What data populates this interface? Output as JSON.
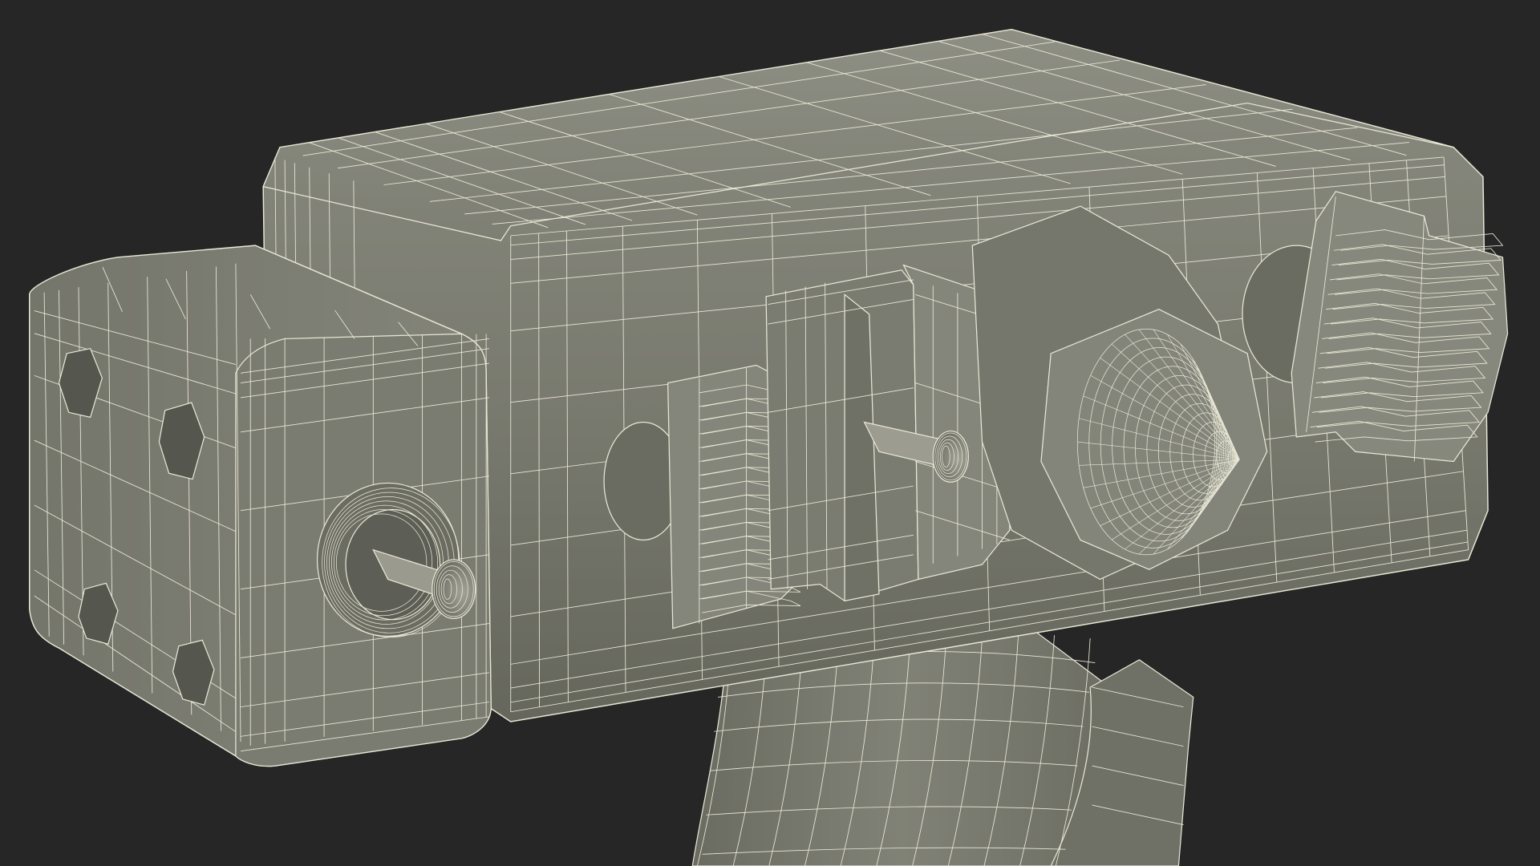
{
  "scene": {
    "subject": "wireframe-3d-model",
    "background_color": "#262626",
    "surface_color": "#7a7b70",
    "surface_shadow_color": "#5d5e55",
    "surface_highlight_color": "#8c8d82",
    "wire_color": "#e9e8d6"
  }
}
